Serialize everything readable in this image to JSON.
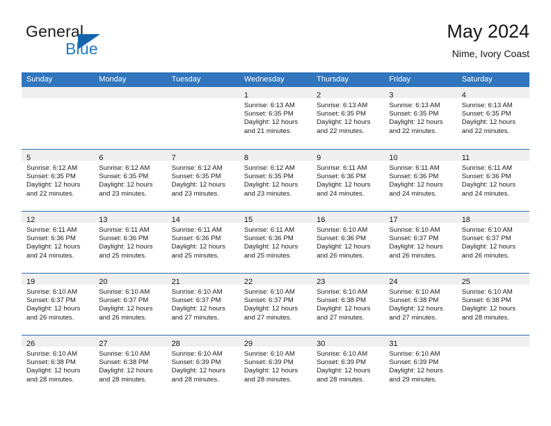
{
  "logo": {
    "word_one": "General",
    "word_two": "Blue",
    "triangle_color": "#1464ab",
    "blue_color": "#1f7ac4"
  },
  "header": {
    "title": "May 2024",
    "subtitle": "Nime, Ivory Coast"
  },
  "theme": {
    "header_blue": "#3176bc",
    "row_divider": "#2a6aa8",
    "day_strip_gray": "#efefef"
  },
  "weekdays": [
    "Sunday",
    "Monday",
    "Tuesday",
    "Wednesday",
    "Thursday",
    "Friday",
    "Saturday"
  ],
  "weeks": [
    [
      {
        "day": "",
        "empty": true
      },
      {
        "day": "",
        "empty": true
      },
      {
        "day": "",
        "empty": true
      },
      {
        "day": "1",
        "sunrise": "Sunrise: 6:13 AM",
        "sunset": "Sunset: 6:35 PM",
        "daylight_1": "Daylight: 12 hours",
        "daylight_2": "and 21 minutes."
      },
      {
        "day": "2",
        "sunrise": "Sunrise: 6:13 AM",
        "sunset": "Sunset: 6:35 PM",
        "daylight_1": "Daylight: 12 hours",
        "daylight_2": "and 22 minutes."
      },
      {
        "day": "3",
        "sunrise": "Sunrise: 6:13 AM",
        "sunset": "Sunset: 6:35 PM",
        "daylight_1": "Daylight: 12 hours",
        "daylight_2": "and 22 minutes."
      },
      {
        "day": "4",
        "sunrise": "Sunrise: 6:13 AM",
        "sunset": "Sunset: 6:35 PM",
        "daylight_1": "Daylight: 12 hours",
        "daylight_2": "and 22 minutes."
      }
    ],
    [
      {
        "day": "5",
        "sunrise": "Sunrise: 6:12 AM",
        "sunset": "Sunset: 6:35 PM",
        "daylight_1": "Daylight: 12 hours",
        "daylight_2": "and 22 minutes."
      },
      {
        "day": "6",
        "sunrise": "Sunrise: 6:12 AM",
        "sunset": "Sunset: 6:35 PM",
        "daylight_1": "Daylight: 12 hours",
        "daylight_2": "and 23 minutes."
      },
      {
        "day": "7",
        "sunrise": "Sunrise: 6:12 AM",
        "sunset": "Sunset: 6:35 PM",
        "daylight_1": "Daylight: 12 hours",
        "daylight_2": "and 23 minutes."
      },
      {
        "day": "8",
        "sunrise": "Sunrise: 6:12 AM",
        "sunset": "Sunset: 6:35 PM",
        "daylight_1": "Daylight: 12 hours",
        "daylight_2": "and 23 minutes."
      },
      {
        "day": "9",
        "sunrise": "Sunrise: 6:11 AM",
        "sunset": "Sunset: 6:36 PM",
        "daylight_1": "Daylight: 12 hours",
        "daylight_2": "and 24 minutes."
      },
      {
        "day": "10",
        "sunrise": "Sunrise: 6:11 AM",
        "sunset": "Sunset: 6:36 PM",
        "daylight_1": "Daylight: 12 hours",
        "daylight_2": "and 24 minutes."
      },
      {
        "day": "11",
        "sunrise": "Sunrise: 6:11 AM",
        "sunset": "Sunset: 6:36 PM",
        "daylight_1": "Daylight: 12 hours",
        "daylight_2": "and 24 minutes."
      }
    ],
    [
      {
        "day": "12",
        "sunrise": "Sunrise: 6:11 AM",
        "sunset": "Sunset: 6:36 PM",
        "daylight_1": "Daylight: 12 hours",
        "daylight_2": "and 24 minutes."
      },
      {
        "day": "13",
        "sunrise": "Sunrise: 6:11 AM",
        "sunset": "Sunset: 6:36 PM",
        "daylight_1": "Daylight: 12 hours",
        "daylight_2": "and 25 minutes."
      },
      {
        "day": "14",
        "sunrise": "Sunrise: 6:11 AM",
        "sunset": "Sunset: 6:36 PM",
        "daylight_1": "Daylight: 12 hours",
        "daylight_2": "and 25 minutes."
      },
      {
        "day": "15",
        "sunrise": "Sunrise: 6:11 AM",
        "sunset": "Sunset: 6:36 PM",
        "daylight_1": "Daylight: 12 hours",
        "daylight_2": "and 25 minutes."
      },
      {
        "day": "16",
        "sunrise": "Sunrise: 6:10 AM",
        "sunset": "Sunset: 6:36 PM",
        "daylight_1": "Daylight: 12 hours",
        "daylight_2": "and 26 minutes."
      },
      {
        "day": "17",
        "sunrise": "Sunrise: 6:10 AM",
        "sunset": "Sunset: 6:37 PM",
        "daylight_1": "Daylight: 12 hours",
        "daylight_2": "and 26 minutes."
      },
      {
        "day": "18",
        "sunrise": "Sunrise: 6:10 AM",
        "sunset": "Sunset: 6:37 PM",
        "daylight_1": "Daylight: 12 hours",
        "daylight_2": "and 26 minutes."
      }
    ],
    [
      {
        "day": "19",
        "sunrise": "Sunrise: 6:10 AM",
        "sunset": "Sunset: 6:37 PM",
        "daylight_1": "Daylight: 12 hours",
        "daylight_2": "and 26 minutes."
      },
      {
        "day": "20",
        "sunrise": "Sunrise: 6:10 AM",
        "sunset": "Sunset: 6:37 PM",
        "daylight_1": "Daylight: 12 hours",
        "daylight_2": "and 26 minutes."
      },
      {
        "day": "21",
        "sunrise": "Sunrise: 6:10 AM",
        "sunset": "Sunset: 6:37 PM",
        "daylight_1": "Daylight: 12 hours",
        "daylight_2": "and 27 minutes."
      },
      {
        "day": "22",
        "sunrise": "Sunrise: 6:10 AM",
        "sunset": "Sunset: 6:37 PM",
        "daylight_1": "Daylight: 12 hours",
        "daylight_2": "and 27 minutes."
      },
      {
        "day": "23",
        "sunrise": "Sunrise: 6:10 AM",
        "sunset": "Sunset: 6:38 PM",
        "daylight_1": "Daylight: 12 hours",
        "daylight_2": "and 27 minutes."
      },
      {
        "day": "24",
        "sunrise": "Sunrise: 6:10 AM",
        "sunset": "Sunset: 6:38 PM",
        "daylight_1": "Daylight: 12 hours",
        "daylight_2": "and 27 minutes."
      },
      {
        "day": "25",
        "sunrise": "Sunrise: 6:10 AM",
        "sunset": "Sunset: 6:38 PM",
        "daylight_1": "Daylight: 12 hours",
        "daylight_2": "and 28 minutes."
      }
    ],
    [
      {
        "day": "26",
        "sunrise": "Sunrise: 6:10 AM",
        "sunset": "Sunset: 6:38 PM",
        "daylight_1": "Daylight: 12 hours",
        "daylight_2": "and 28 minutes."
      },
      {
        "day": "27",
        "sunrise": "Sunrise: 6:10 AM",
        "sunset": "Sunset: 6:38 PM",
        "daylight_1": "Daylight: 12 hours",
        "daylight_2": "and 28 minutes."
      },
      {
        "day": "28",
        "sunrise": "Sunrise: 6:10 AM",
        "sunset": "Sunset: 6:39 PM",
        "daylight_1": "Daylight: 12 hours",
        "daylight_2": "and 28 minutes."
      },
      {
        "day": "29",
        "sunrise": "Sunrise: 6:10 AM",
        "sunset": "Sunset: 6:39 PM",
        "daylight_1": "Daylight: 12 hours",
        "daylight_2": "and 28 minutes."
      },
      {
        "day": "30",
        "sunrise": "Sunrise: 6:10 AM",
        "sunset": "Sunset: 6:39 PM",
        "daylight_1": "Daylight: 12 hours",
        "daylight_2": "and 28 minutes."
      },
      {
        "day": "31",
        "sunrise": "Sunrise: 6:10 AM",
        "sunset": "Sunset: 6:39 PM",
        "daylight_1": "Daylight: 12 hours",
        "daylight_2": "and 29 minutes."
      },
      {
        "day": "",
        "empty": true
      }
    ]
  ]
}
